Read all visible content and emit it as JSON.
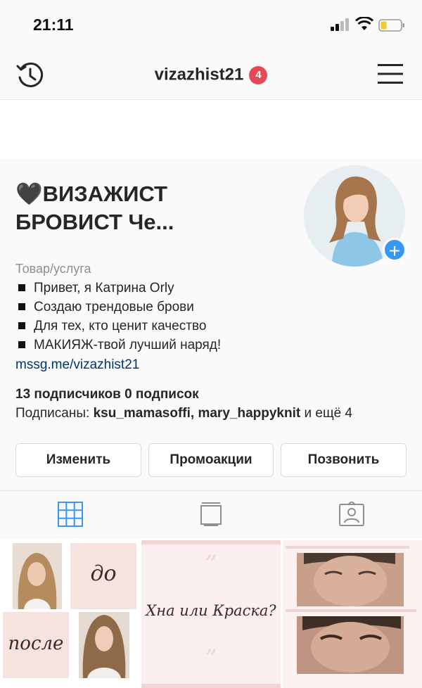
{
  "status_bar": {
    "time": "21:11"
  },
  "nav": {
    "username": "vizazhist21",
    "badge_count": "4"
  },
  "profile": {
    "name_line1": "🖤ВИЗАЖИСТ",
    "name_line2": "БРОВИСТ Че...",
    "category": "Товар/услуга",
    "bio": [
      "Привет, я Катрина Orly",
      "Создаю трендовые брови",
      "Для тех, кто ценит качество",
      "МАКИЯЖ-твой лучший наряд!"
    ],
    "link": "mssg.me/vizazhist21",
    "followers": "13 подписчиков",
    "following": "0 подписок",
    "followed_by_prefix": "Подписаны: ",
    "followed_by_users": "ksu_mamasoffi, mary_happyknit",
    "followed_by_suffix": " и ещё 4"
  },
  "buttons": {
    "edit": "Изменить",
    "promo": "Промоакции",
    "call": "Позвонить"
  },
  "tabs": [
    "grid-icon",
    "tv-icon",
    "tagged-icon"
  ],
  "posts": {
    "before_label": "до",
    "after_label": "после",
    "quote_text": "Хна или Краска?",
    "quote_mark": "”"
  },
  "colors": {
    "accent": "#3897f0",
    "badge": "#e44a55",
    "tile_pink": "#f6e3e0"
  }
}
